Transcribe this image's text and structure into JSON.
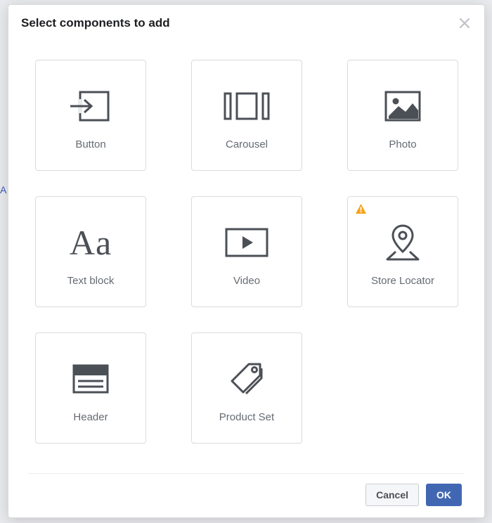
{
  "backdrop_hint": "A",
  "modal": {
    "title": "Select components to add",
    "cards": [
      {
        "id": "button",
        "label": "Button",
        "icon": "button-enter-icon",
        "warning": false
      },
      {
        "id": "carousel",
        "label": "Carousel",
        "icon": "carousel-icon",
        "warning": false
      },
      {
        "id": "photo",
        "label": "Photo",
        "icon": "photo-icon",
        "warning": false
      },
      {
        "id": "text-block",
        "label": "Text block",
        "icon": "text-aa-icon",
        "warning": false
      },
      {
        "id": "video",
        "label": "Video",
        "icon": "video-icon",
        "warning": false
      },
      {
        "id": "store-locator",
        "label": "Store Locator",
        "icon": "pin-icon",
        "warning": true
      },
      {
        "id": "header",
        "label": "Header",
        "icon": "header-icon",
        "warning": false
      },
      {
        "id": "product-set",
        "label": "Product Set",
        "icon": "tag-icon",
        "warning": false
      }
    ],
    "footer": {
      "cancel_label": "Cancel",
      "ok_label": "OK"
    }
  }
}
